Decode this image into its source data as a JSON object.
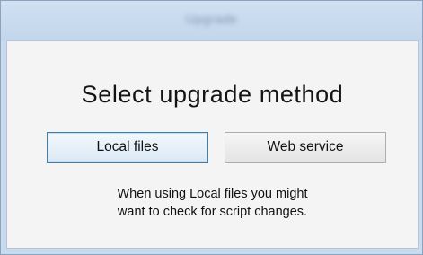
{
  "window": {
    "title": "Upgrade"
  },
  "dialog": {
    "heading": "Select upgrade method",
    "buttons": {
      "local_files": "Local files",
      "web_service": "Web service"
    },
    "info_lines": [
      "When using Local files you might",
      "want to check for script changes."
    ]
  }
}
